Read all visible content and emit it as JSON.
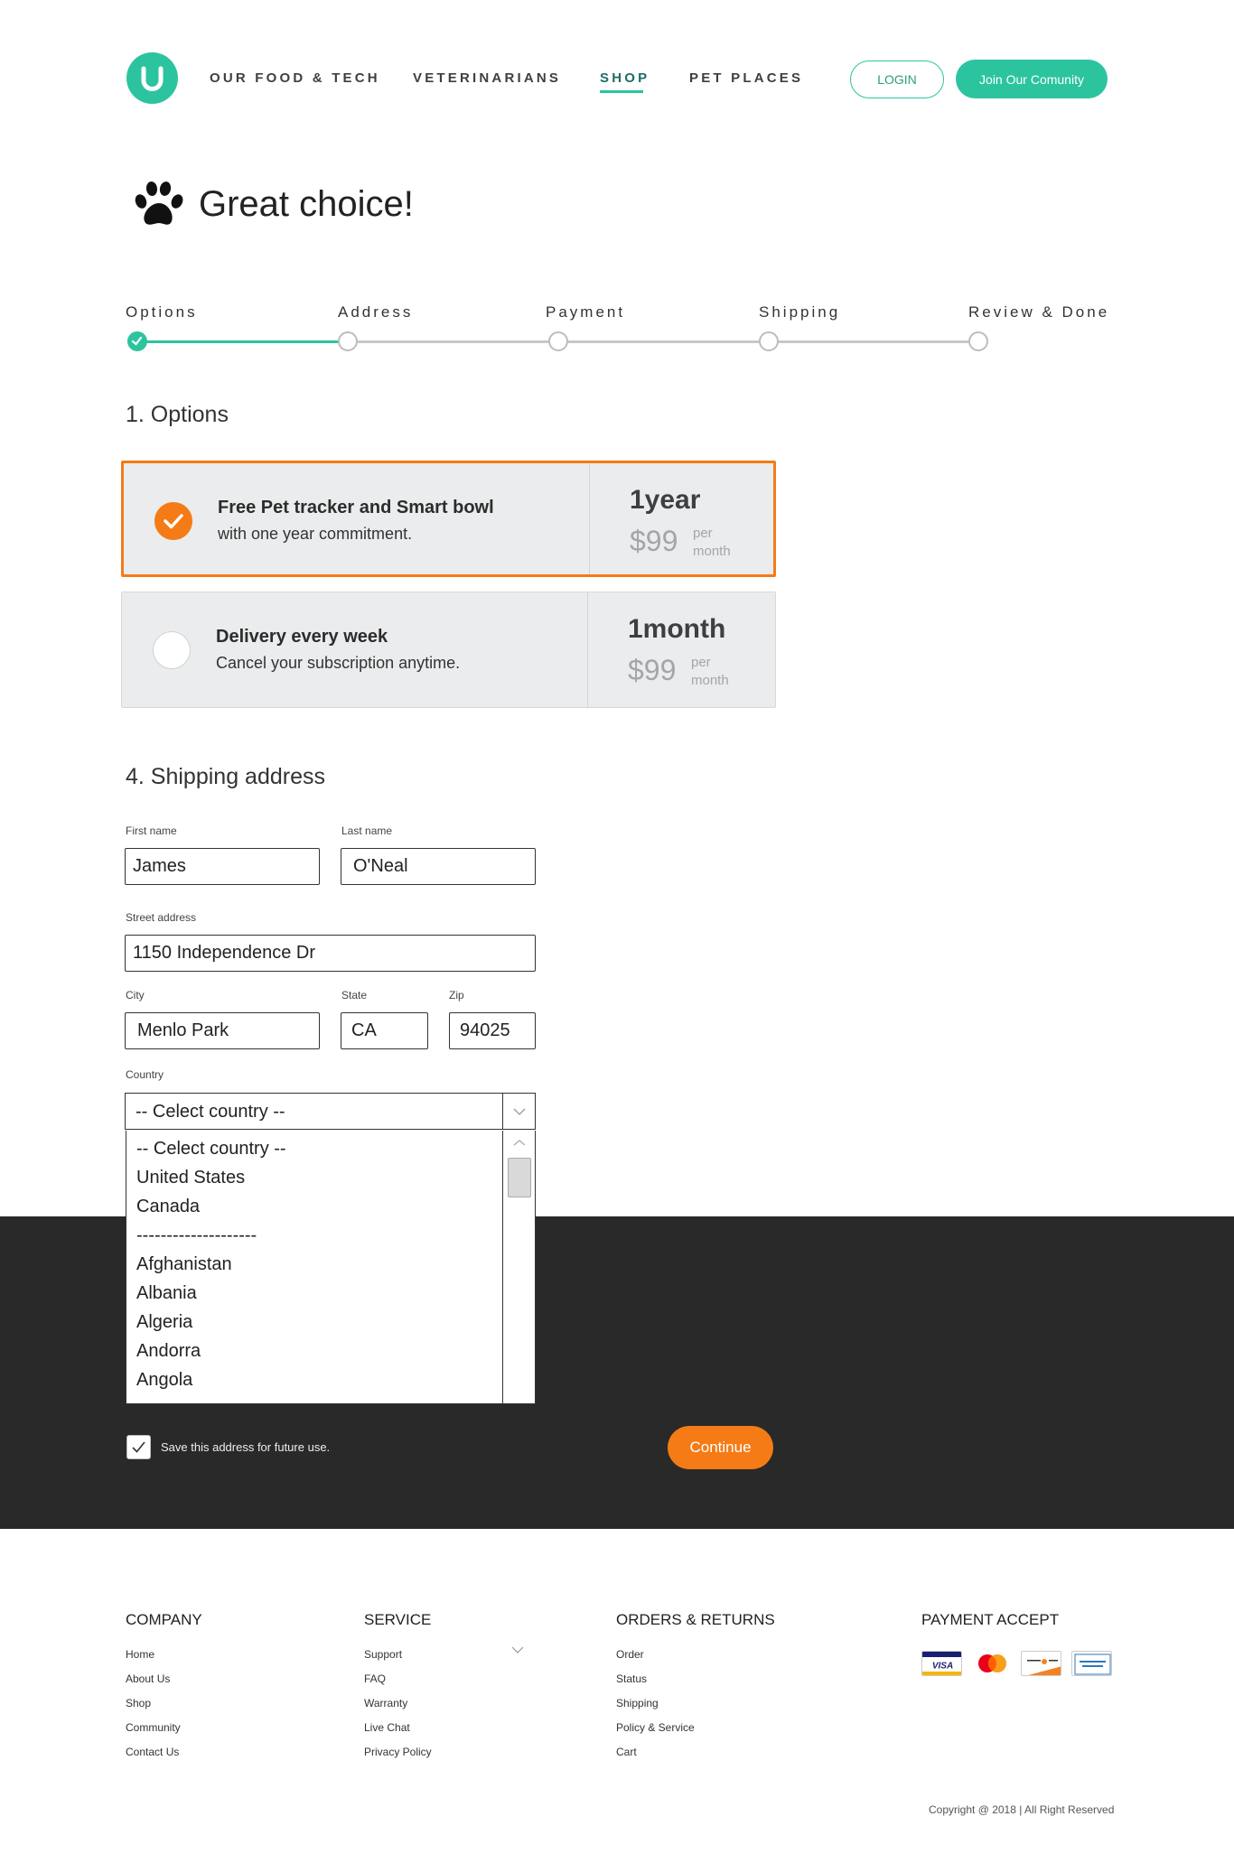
{
  "header": {
    "nav": [
      "OUR FOOD & TECH",
      "VETERINARIANS",
      "SHOP",
      "PET PLACES"
    ],
    "active_nav": "SHOP",
    "login_label": "LOGIN",
    "join_label": "Join Our Comunity",
    "brand_color": "#2cc49f"
  },
  "page": {
    "title": "Great choice!"
  },
  "steps": {
    "labels": [
      "Options",
      "Address",
      "Payment",
      "Shipping",
      "Review & Done"
    ],
    "completed_count": 1
  },
  "options": {
    "section_title": "1. Options",
    "items": [
      {
        "title": "Free Pet tracker and Smart bowl",
        "subtitle": "with one year commitment.",
        "term": "1year",
        "price": "$99",
        "per_1": "per",
        "per_2": "month",
        "selected": true
      },
      {
        "title": "Delivery every week",
        "subtitle": "Cancel your subscription anytime.",
        "term": "1month",
        "price": "$99",
        "per_1": "per",
        "per_2": "month",
        "selected": false
      }
    ],
    "accent_color": "#f47b16"
  },
  "shipping": {
    "section_title": "4. Shipping address",
    "first_name_label": "First name",
    "first_name": "James",
    "last_name_label": "Last name",
    "last_name": "O'Neal",
    "street_label": "Street address",
    "street": "1150 Independence Dr",
    "city_label": "City",
    "city": "Menlo Park",
    "state_label": "State",
    "state": "CA",
    "zip_label": "Zip",
    "zip": "94025",
    "country_label": "Country",
    "country_value": "-- Celect country --",
    "country_options": [
      "-- Celect country --",
      "United States",
      "Canada",
      "--------------------",
      "Afghanistan",
      "Albania",
      "Algeria",
      "Andorra",
      "Angola"
    ],
    "save_label": "Save this address for future use.",
    "save_checked": true,
    "continue_label": "Continue"
  },
  "footer": {
    "columns": [
      {
        "title": "COMPANY",
        "links": [
          "Home",
          "About Us",
          "Shop",
          "Community",
          "Contact Us"
        ]
      },
      {
        "title": "SERVICE",
        "links": [
          "Support",
          "FAQ",
          "Warranty",
          "Live Chat",
          "Privacy Policy"
        ]
      },
      {
        "title": "ORDERS & RETURNS",
        "links": [
          "Order",
          "Status",
          "Shipping",
          "Policy & Service",
          "Cart"
        ]
      }
    ],
    "payment_title": "PAYMENT ACCEPT",
    "payment_cards": [
      "visa-card-icon",
      "mastercard-icon",
      "discover-card-icon",
      "american-express-icon"
    ],
    "copyright": "Copyright @ 2018 | All Right Reserved"
  }
}
